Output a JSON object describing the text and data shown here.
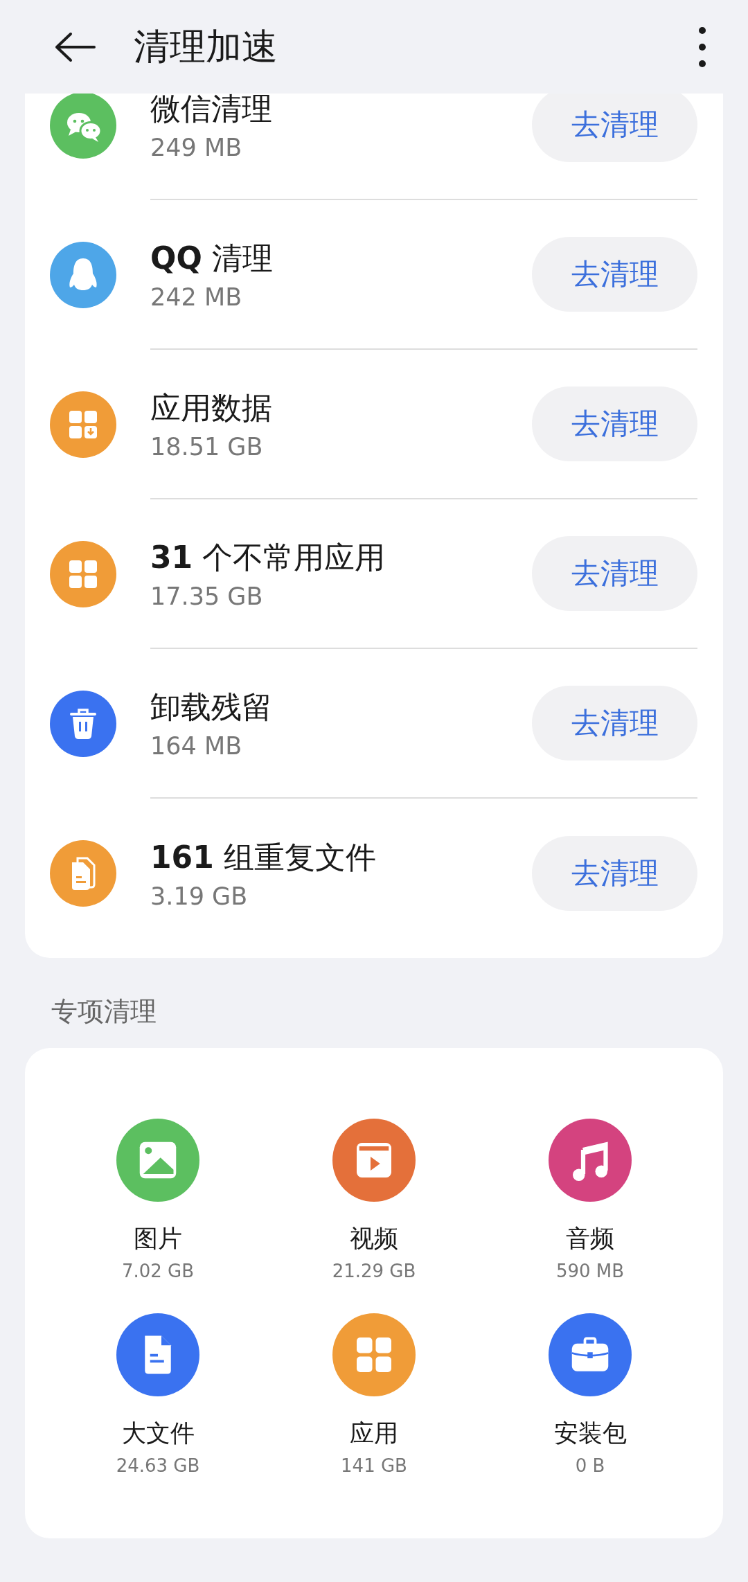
{
  "header": {
    "title": "清理加速"
  },
  "clean_items": [
    {
      "color": "#5cbf60",
      "title": "微信清理",
      "size": "249 MB",
      "button": "去清理"
    },
    {
      "color": "#4ea6e8",
      "title": "**QQ** 清理",
      "size": "242 MB",
      "button": "去清理"
    },
    {
      "color": "#f09c38",
      "title": "应用数据",
      "size": "18.51 GB",
      "button": "去清理"
    },
    {
      "color": "#f09c38",
      "title": "**31** 个不常用应用",
      "size": "17.35 GB",
      "button": "去清理"
    },
    {
      "color": "#3a72f0",
      "title": "卸载残留",
      "size": "164 MB",
      "button": "去清理"
    },
    {
      "color": "#f09c38",
      "title": "**161** 组重复文件",
      "size": "3.19 GB",
      "button": "去清理"
    }
  ],
  "special_section": {
    "title": "专项清理",
    "items": [
      {
        "color": "#5cbf60",
        "label": "图片",
        "size": "7.02 GB"
      },
      {
        "color": "#e4703a",
        "label": "视频",
        "size": "21.29 GB"
      },
      {
        "color": "#d4437f",
        "label": "音频",
        "size": "590 MB"
      },
      {
        "color": "#3a72f0",
        "label": "大文件",
        "size": "24.63 GB"
      },
      {
        "color": "#f09c38",
        "label": "应用",
        "size": "141 GB"
      },
      {
        "color": "#3a72f0",
        "label": "安装包",
        "size": "0 B"
      }
    ]
  }
}
